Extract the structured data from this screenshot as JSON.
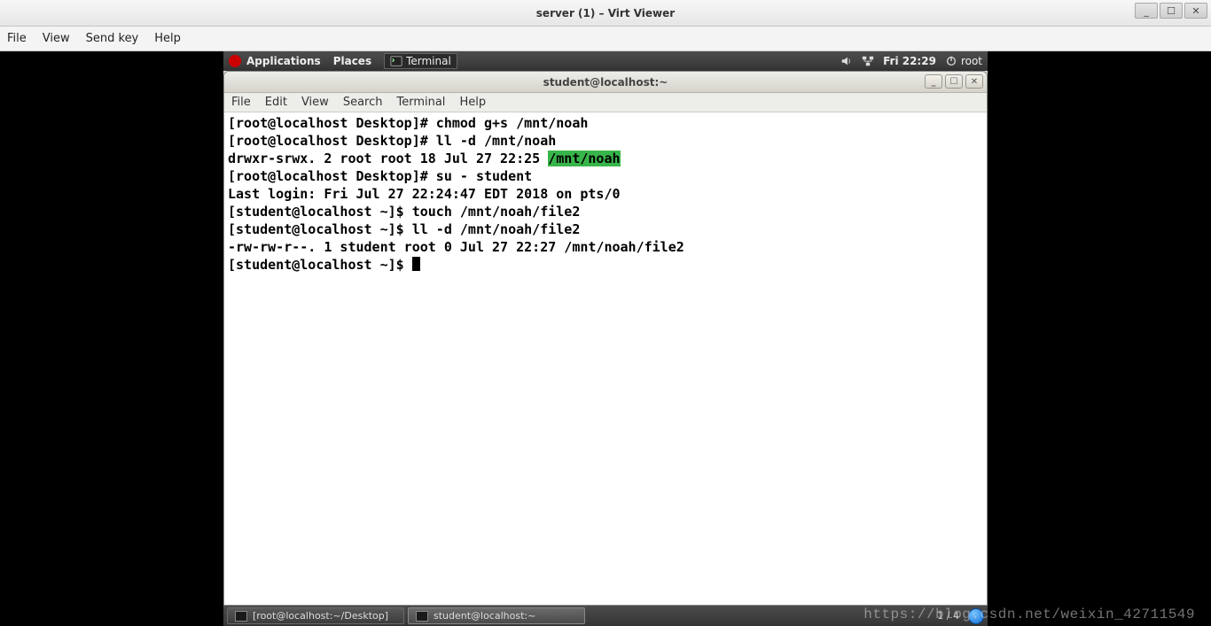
{
  "viewer": {
    "title": "server (1) – Virt Viewer",
    "menu": [
      "File",
      "View",
      "Send key",
      "Help"
    ],
    "win": [
      "_",
      "☐",
      "✕"
    ]
  },
  "gnome_top": {
    "applications": "Applications",
    "places": "Places",
    "terminal_tab": "Terminal",
    "clock": "Fri 22:29",
    "user": "root"
  },
  "term_win": {
    "title": "student@localhost:~",
    "menu": [
      "File",
      "Edit",
      "View",
      "Search",
      "Terminal",
      "Help"
    ],
    "btns": [
      "_",
      "☐",
      "✕"
    ]
  },
  "terminal_lines": [
    {
      "t": "[root@localhost Desktop]# chmod g+s /mnt/noah"
    },
    {
      "t": "[root@localhost Desktop]# ll -d /mnt/noah"
    },
    {
      "pre": "drwxr-srwx. 2 root root 18 Jul 27 22:25 ",
      "hl": "/mnt/noah"
    },
    {
      "t": "[root@localhost Desktop]# su - student"
    },
    {
      "t": "Last login: Fri Jul 27 22:24:47 EDT 2018 on pts/0"
    },
    {
      "t": "[student@localhost ~]$ touch /mnt/noah/file2"
    },
    {
      "t": "[student@localhost ~]$ ll -d /mnt/noah/file2"
    },
    {
      "t": "-rw-rw-r--. 1 student root 0 Jul 27 22:27 /mnt/noah/file2"
    },
    {
      "pre": "[student@localhost ~]$ ",
      "cursor": true
    }
  ],
  "gnome_bot": {
    "tasks": [
      {
        "label": "[root@localhost:~/Desktop]",
        "active": false
      },
      {
        "label": "student@localhost:~",
        "active": true
      }
    ],
    "workspace": "1 / 4"
  },
  "watermark": "https://blog.csdn.net/weixin_42711549"
}
